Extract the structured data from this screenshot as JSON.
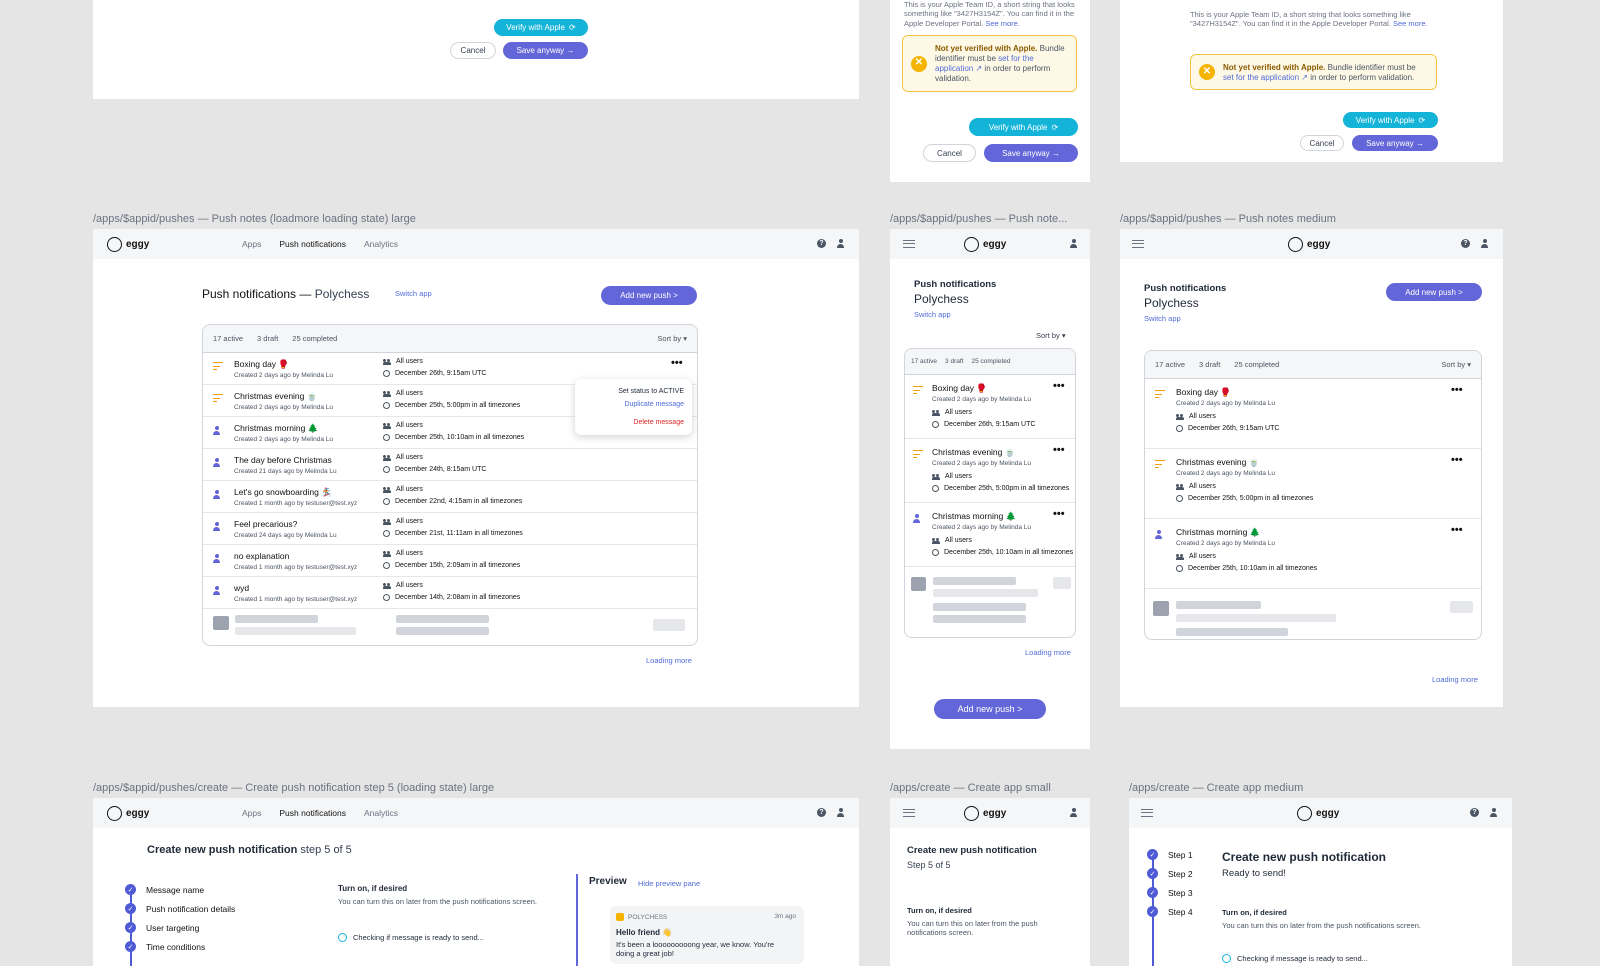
{
  "verify_frames": {
    "verify_label": "Verify with Apple",
    "save_anyway_label": "Save anyway →",
    "cancel_label": "Cancel",
    "team_id_help_small": "This is your Apple Team ID, a short string that looks something like \"3427H3154Z\". You can find it in the Apple Developer Portal.",
    "team_id_help_medium": "This is your Apple Team ID, a short string that looks something like \"3427H3154Z\". You can find it in the Apple Developer Portal.",
    "see_more": "See more.",
    "warning_title": "Not yet verified with Apple.",
    "warning_text_a": "Bundle identifier must be",
    "warning_link": "set for the application ↗",
    "warning_text_b": "in order to perform validation."
  },
  "labels": {
    "pushes_large": "/apps/$appid/pushes — Push notes (loadmore loading state) large",
    "pushes_small": "/apps/$appid/pushes — Push note...",
    "pushes_medium": "/apps/$appid/pushes — Push notes medium",
    "create_large": "/apps/$appid/pushes/create — Create push notification step 5 (loading state) large",
    "create_small": "/apps/create — Create app small",
    "create_medium": "/apps/create — Create app medium"
  },
  "brand": {
    "name": "eggy",
    "accent": "#6366d8",
    "teal": "#14b4d8"
  },
  "nav": {
    "apps": "Apps",
    "push": "Push notifications",
    "analytics": "Analytics"
  },
  "pushes": {
    "title_prefix": "Push notifications —",
    "app_name": "Polychess",
    "title_short": "Push notifications",
    "switch_app": "Switch app",
    "add_new": "Add new push >",
    "stats": {
      "active": "17 active",
      "draft": "3 draft",
      "completed": "25 completed"
    },
    "sort_by": "Sort by ▾",
    "loading_more": "Loading more",
    "menu": {
      "set_active": "Set status to ACTIVE",
      "duplicate": "Duplicate message",
      "delete": "Delete message"
    },
    "rows": [
      {
        "status": "draft",
        "title": "Boxing day 🥊",
        "sub": "Created 2 days ago by Melinda Lu",
        "audience": "All users",
        "when": "December 26th, 9:15am UTC"
      },
      {
        "status": "draft",
        "title": "Christmas evening 🍵",
        "sub": "Created 2 days ago by Melinda Lu",
        "audience": "All users",
        "when": "December 25th, 5:00pm in all timezones"
      },
      {
        "status": "completed",
        "title": "Christmas morning 🌲",
        "sub": "Created 2 days ago by Melinda Lu",
        "audience": "All users",
        "when": "December 25th, 10:10am in all timezones"
      },
      {
        "status": "completed",
        "title": "The day before Christmas",
        "sub": "Created 21 days ago by Melinda Lu",
        "audience": "All users",
        "when": "December 24th, 8:15am UTC"
      },
      {
        "status": "completed",
        "title": "Let's go snowboarding 🏂",
        "sub": "Created 1 month ago by testuser@test.xyz",
        "audience": "All users",
        "when": "December 22nd, 4:15am in all timezones"
      },
      {
        "status": "completed",
        "title": "Feel precarious?",
        "sub": "Created 24 days ago by Melinda Lu",
        "audience": "All users",
        "when": "December 21st, 11:11am in all timezones"
      },
      {
        "status": "completed",
        "title": "no explanation",
        "sub": "Created 1 month ago by testuser@test.xyz",
        "audience": "All users",
        "when": "December 15th, 2:09am in all timezones"
      },
      {
        "status": "completed",
        "title": "wyd",
        "sub": "Created 1 month ago by testuser@test.xyz",
        "audience": "All users",
        "when": "December 14th, 2:08am in all timezones"
      }
    ]
  },
  "create": {
    "title": "Create new push notification",
    "step_large": "step 5 of 5",
    "step_small": "Step 5 of 5",
    "ready": "Ready to send!",
    "steps_large": [
      "Message name",
      "Push notification details",
      "User targeting",
      "Time conditions"
    ],
    "steps_medium": [
      "Step 1",
      "Step 2",
      "Step 3",
      "Step 4"
    ],
    "turn_on_title": "Turn on, if desired",
    "turn_on_text": "You can turn this on later from the push notifications screen.",
    "checking": "Checking if message is ready to send...",
    "preview": "Preview",
    "hide_preview": "Hide preview pane",
    "preview_app": "POLYCHESS",
    "preview_time": "3m ago",
    "preview_title": "Hello friend 👋",
    "preview_body": "It's been a looooooooong year, we know. You're doing a great job!"
  }
}
